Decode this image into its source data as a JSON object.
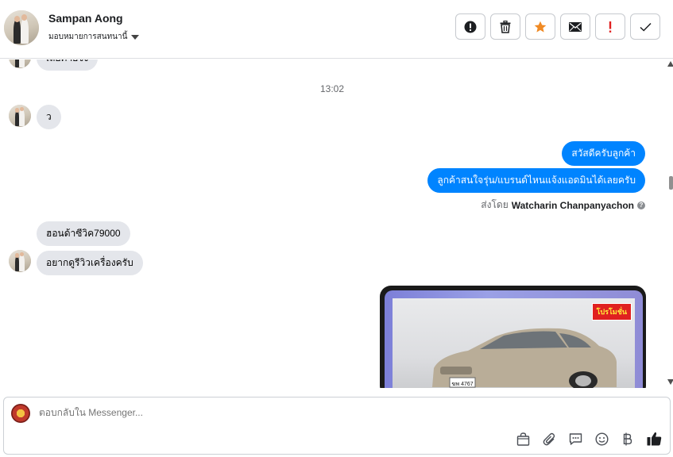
{
  "header": {
    "name": "Sampan Aong",
    "assign_label": "มอบหมายการสนทนานี้",
    "actions": [
      {
        "name": "report-icon",
        "label": "!"
      },
      {
        "name": "trash-icon"
      },
      {
        "name": "star-icon"
      },
      {
        "name": "mail-icon"
      },
      {
        "name": "mark-important-icon",
        "label": "!"
      },
      {
        "name": "check-icon"
      }
    ],
    "colors": {
      "star": "#f08a24",
      "important": "#e02020"
    }
  },
  "chat": {
    "partial_message": "เลยค่ายจึง",
    "timestamp": "13:02",
    "messages_in_1": "ว",
    "messages_out": [
      "สวัสดีครับลูกค้า",
      "ลูกค้าสนใจรุ่น/แบรนด์ไหนแจ้งแอดมินได้เลยครับ"
    ],
    "sent_by_prefix": "ส่งโดย",
    "sent_by_name": "Watcharin Chanpanyachon",
    "messages_in_2": [
      "ฮอนด้าซีวิค79000",
      "อยากดูรีวิวเครื่องครับ"
    ],
    "image_promo_tag": "โปรโมชั่น",
    "plate_text": "ฆพ 4767"
  },
  "composer": {
    "placeholder": "ตอบกลับใน Messenger...",
    "tools": [
      "shopping-bag-icon",
      "paperclip-icon",
      "saved-reply-icon",
      "emoji-icon",
      "baht-icon",
      "like-icon"
    ]
  },
  "colors": {
    "accent": "#0084ff",
    "bubble_in": "#e4e6eb"
  }
}
